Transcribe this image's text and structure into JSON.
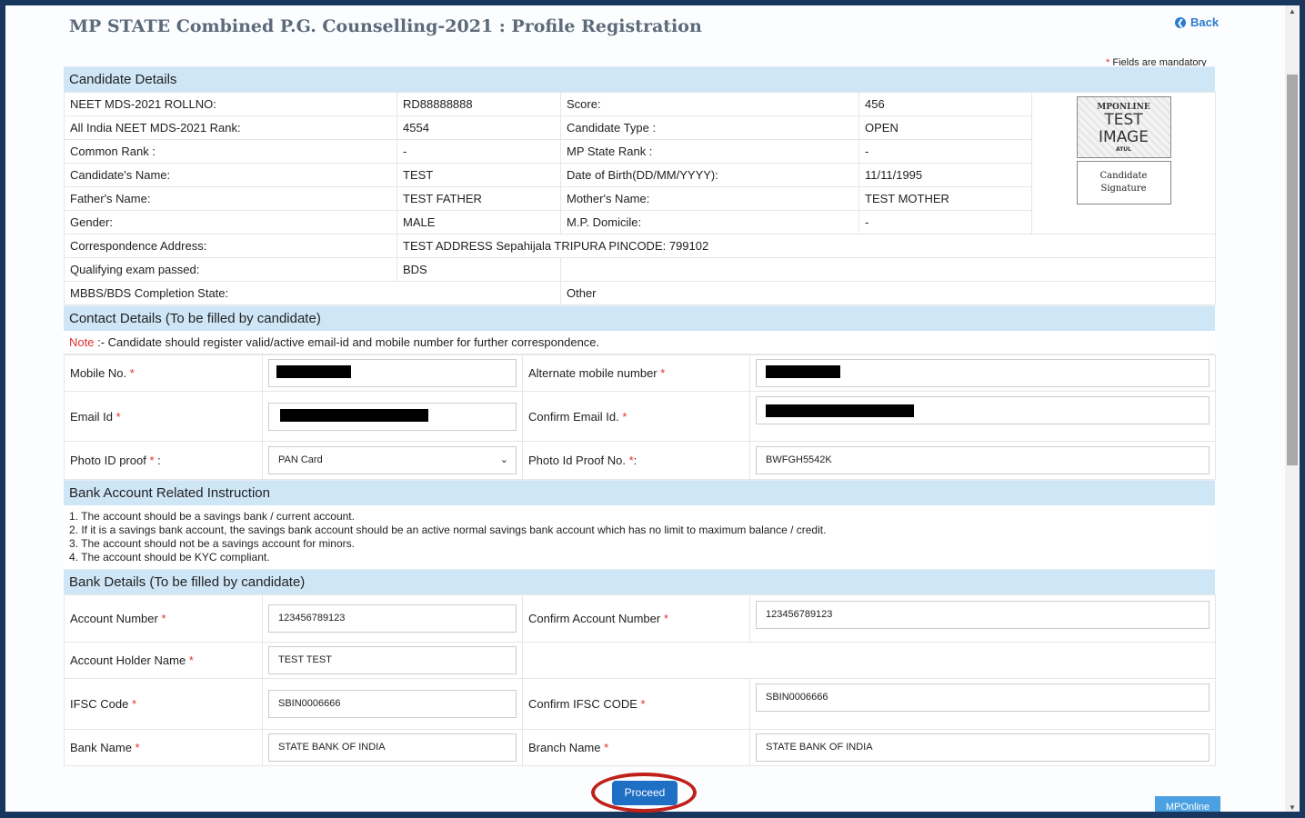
{
  "header": {
    "title": "MP STATE Combined P.G. Counselling-2021 : Profile Registration",
    "back_label": "Back",
    "mandatory_note": "Fields are mandatory",
    "asterisk": "*"
  },
  "candidate": {
    "section_title": "Candidate Details",
    "rows": [
      [
        "NEET MDS-2021 ROLLNO:",
        "RD88888888",
        "Score:",
        "456"
      ],
      [
        "All India NEET MDS-2021 Rank:",
        "4554",
        "Candidate Type :",
        "OPEN"
      ],
      [
        "Common Rank :",
        "-",
        "MP State Rank :",
        "-"
      ],
      [
        "Candidate's Name:",
        "TEST",
        "Date of Birth(DD/MM/YYYY):",
        "11/11/1995"
      ],
      [
        "Father's Name:",
        "TEST FATHER",
        "Mother's Name:",
        "TEST MOTHER"
      ],
      [
        "Gender:",
        "MALE",
        "M.P. Domicile:",
        "-"
      ]
    ],
    "address_label": "Correspondence Address:",
    "address_value": "TEST ADDRESS Sepahijala TRIPURA PINCODE: 799102",
    "qualifying_label": "Qualifying exam passed:",
    "qualifying_value": "BDS",
    "completion_label": "MBBS/BDS Completion State:",
    "completion_value": "Other",
    "photo": {
      "line1": "MPONLINE",
      "line2": "TEST",
      "line3": "IMAGE",
      "line4": "ATUL"
    },
    "signature": {
      "line1": "Candidate",
      "line2": "Signature"
    }
  },
  "contact": {
    "section_title": "Contact Details (To be filled by candidate)",
    "note_label": "Note",
    "note_text": " :- Candidate should register valid/active email-id and mobile number for further correspondence.",
    "mobile_label": "Mobile No.",
    "alt_mobile_label": "Alternate mobile number",
    "email_label": "Email Id",
    "confirm_email_label": "Confirm Email Id.",
    "photo_id_label": "Photo ID proof",
    "photo_id_suffix": " :",
    "photo_id_value": "PAN Card",
    "photo_id_no_label": "Photo Id Proof No.",
    "photo_id_no_suffix": ":",
    "photo_id_no_value": "BWFGH5542K"
  },
  "bank_instructions": {
    "section_title": "Bank Account Related Instruction",
    "items": [
      "1. The account should be a savings bank / current account.",
      "2. If it is a savings bank account, the savings bank account should be an active normal savings bank account which has no limit to maximum balance / credit.",
      "3. The account should not be a savings account for minors.",
      "4. The account should be KYC compliant."
    ]
  },
  "bank": {
    "section_title": "Bank Details (To be filled by candidate)",
    "account_number_label": "Account Number",
    "account_number_value": "123456789123",
    "confirm_account_label": "Confirm Account Number",
    "confirm_account_value": "123456789123",
    "holder_label": "Account Holder Name",
    "holder_value": "TEST TEST",
    "ifsc_label": "IFSC Code",
    "ifsc_value": "SBIN0006666",
    "confirm_ifsc_label": "Confirm IFSC CODE",
    "confirm_ifsc_value": "SBIN0006666",
    "bank_name_label": "Bank Name",
    "bank_name_value": "STATE BANK OF INDIA",
    "branch_label": "Branch Name",
    "branch_value": "STATE BANK OF INDIA"
  },
  "actions": {
    "proceed_label": "Proceed",
    "corner_tag": "MPOnline"
  }
}
